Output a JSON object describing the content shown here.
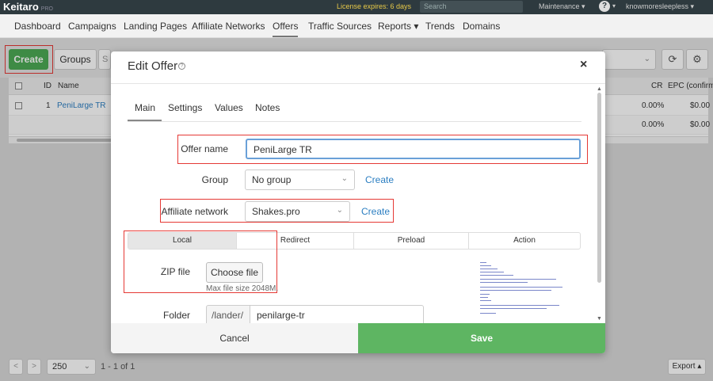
{
  "topbar": {
    "logo": "Keitaro",
    "logo_edition": "PRO",
    "license": "License expires: 6 days",
    "search_placeholder": "Search",
    "maintenance": "Maintenance ▾",
    "help_icon": "?",
    "help_caret": "▾",
    "user": "knowmoresleepless ▾"
  },
  "nav": {
    "items": [
      "Dashboard",
      "Campaigns",
      "Landing Pages",
      "Affiliate Networks",
      "Offers",
      "Traffic Sources",
      "Reports ▾",
      "Trends",
      "Domains"
    ],
    "active": "Offers"
  },
  "toolbar": {
    "create_label": "Create",
    "groups_label": "Groups",
    "search_stub": "S"
  },
  "table": {
    "headers": {
      "id": "ID",
      "name": "Name",
      "cr": "CR",
      "epc": "EPC (confirm"
    },
    "rows": [
      {
        "id": "1",
        "name": "PeniLarge TR",
        "cr": "0.00%",
        "epc": "$0.00"
      },
      {
        "id": "",
        "name": "",
        "cr": "0.00%",
        "epc": "$0.00"
      }
    ]
  },
  "pager": {
    "prev": "<",
    "next": ">",
    "page_size": "250",
    "info": "1 - 1 of 1",
    "export": "Export ▴"
  },
  "modal": {
    "title": "Edit Offer",
    "close": "×",
    "tabs": [
      "Main",
      "Settings",
      "Values",
      "Notes"
    ],
    "active_tab": "Main",
    "offer_name_label": "Offer name",
    "offer_name_value": "PeniLarge TR",
    "group_label": "Group",
    "group_value": "No group",
    "group_create": "Create",
    "affiliate_label": "Affiliate network",
    "affiliate_value": "Shakes.pro",
    "affiliate_create": "Create",
    "type_tabs": [
      "Local",
      "Redirect",
      "Preload",
      "Action"
    ],
    "active_type": "Local",
    "zip_label": "ZIP file",
    "choose_file": "Choose file",
    "max_size": "Max file size 2048M.",
    "folder_label": "Folder",
    "folder_prefix": "/lander/",
    "folder_value": "penilarge-tr",
    "cancel": "Cancel",
    "save": "Save"
  },
  "colors": {
    "accent_green": "#4caa55",
    "link_blue": "#2b7ec1",
    "highlight_red": "#e53935",
    "license_yellow": "#e7c948"
  }
}
